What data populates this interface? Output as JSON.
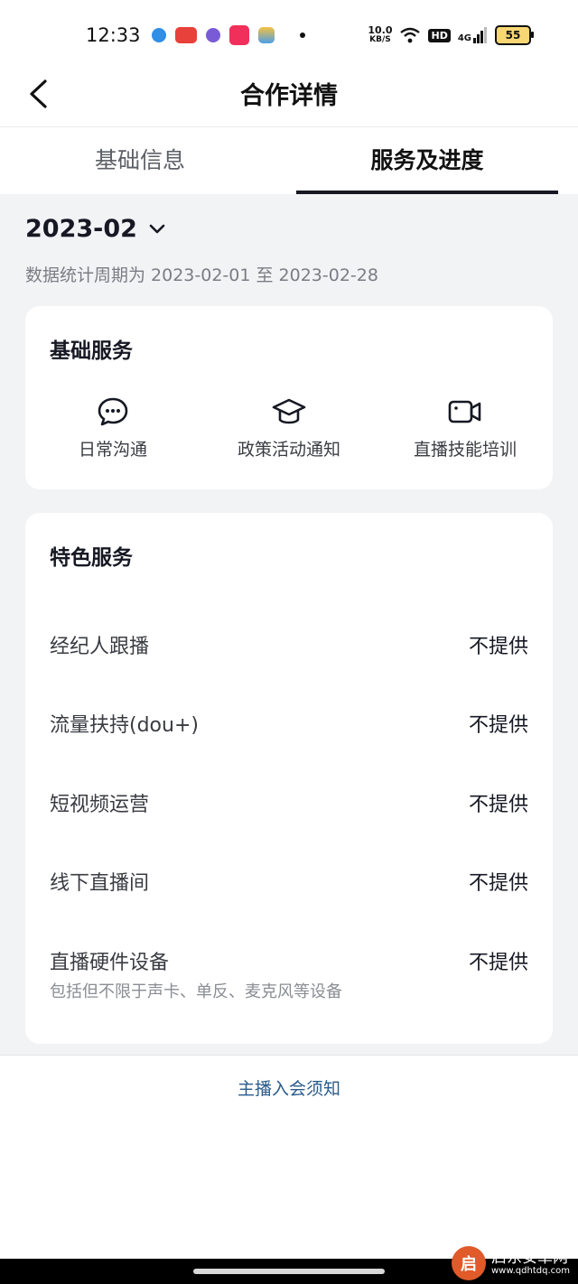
{
  "status_bar": {
    "time": "12:33",
    "net_speed_value": "10.0",
    "net_speed_unit": "KB/S",
    "hd_label": "HD",
    "network_label": "4G",
    "battery_level": "55"
  },
  "nav": {
    "title": "合作详情"
  },
  "tabs": [
    {
      "label": "基础信息",
      "active": false
    },
    {
      "label": "服务及进度",
      "active": true
    }
  ],
  "period": {
    "month": "2023-02",
    "description": "数据统计周期为 2023-02-01 至 2023-02-28"
  },
  "basic_services": {
    "title": "基础服务",
    "items": [
      {
        "label": "日常沟通",
        "icon": "chat-bubbles-icon"
      },
      {
        "label": "政策活动通知",
        "icon": "graduation-cap-icon"
      },
      {
        "label": "直播技能培训",
        "icon": "video-camera-icon"
      }
    ]
  },
  "special_services": {
    "title": "特色服务",
    "items": [
      {
        "name": "经纪人跟播",
        "status": "不提供"
      },
      {
        "name": "流量扶持(dou+)",
        "status": "不提供"
      },
      {
        "name": "短视频运营",
        "status": "不提供"
      },
      {
        "name": "线下直播间",
        "status": "不提供"
      },
      {
        "name": "直播硬件设备",
        "status": "不提供",
        "note": "包括但不限于声卡、单反、麦克风等设备"
      }
    ]
  },
  "footer": {
    "link": "主播入会须知"
  },
  "watermark": {
    "logo_char": "启",
    "name": "启东安卓网",
    "url": "www.qdhtdq.com"
  },
  "colors": {
    "accent": "#161823",
    "link": "#2a5b8c",
    "background": "#f2f3f5"
  }
}
